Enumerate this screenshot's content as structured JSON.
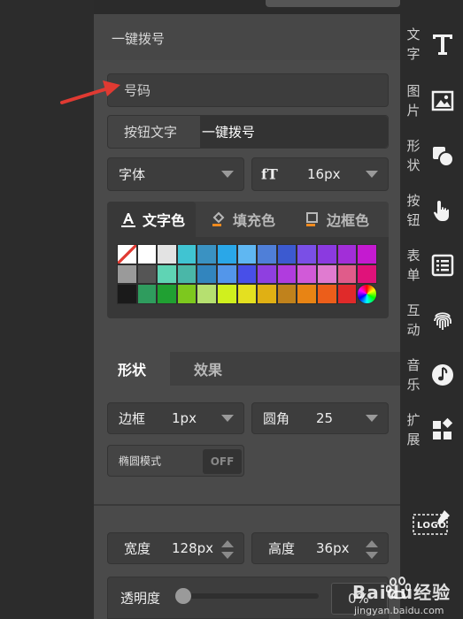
{
  "top_button_label": "",
  "panel": {
    "title": "一键拨号",
    "number_placeholder": "号码",
    "button_text_label": "按钮文字",
    "button_text_value": "一键拨号",
    "font_label": "字体",
    "font_size": "16px"
  },
  "color_tabs": [
    {
      "label": "文字色",
      "icon": "text-color-icon"
    },
    {
      "label": "填充色",
      "icon": "fill-bucket-icon"
    },
    {
      "label": "边框色",
      "icon": "border-color-icon"
    }
  ],
  "palette": [
    [
      "#ffffff",
      "#ffffff",
      "#e3e3e3",
      "#40c4d2",
      "#3a92c2",
      "#2aa7e8",
      "#5fb7f2",
      "#4f7fd8",
      "#3c5ad0",
      "#7a4fe6",
      "#8b3ae0",
      "#a22ed8",
      "#c41ad0"
    ],
    [
      "#9a9a9a",
      "#555555",
      "#5fd4b4",
      "#4ab7a8",
      "#3285be",
      "#5396ea",
      "#484fe8",
      "#8f3fe0",
      "#b03cde",
      "#d15ad8",
      "#e07bd0",
      "#e05c8a",
      "#e0127a"
    ],
    [
      "#1a1a1a",
      "#2f9c5e",
      "#20a032",
      "#7dc81e",
      "#b6e070",
      "#d0f01e",
      "#e4e020",
      "#e0b014",
      "#c0821c",
      "#e88414",
      "#ec5e1a",
      "#e02a2a",
      "rainbow"
    ]
  ],
  "shape_tabs": [
    "形状",
    "效果"
  ],
  "border": {
    "label": "边框",
    "value": "1px"
  },
  "radius": {
    "label": "圆角",
    "value": "25"
  },
  "ellipse": {
    "label": "椭圆模式",
    "toggle": "OFF"
  },
  "width": {
    "label": "宽度",
    "value": "128px"
  },
  "height": {
    "label": "高度",
    "value": "36px"
  },
  "opacity": {
    "label": "透明度",
    "value": "0%",
    "level": 0
  },
  "sidebar": [
    {
      "label": "文字",
      "icon": "text-T-icon"
    },
    {
      "label": "图片",
      "icon": "image-icon"
    },
    {
      "label": "形状",
      "icon": "shapes-icon"
    },
    {
      "label": "按钮",
      "icon": "hand-pointer-icon"
    },
    {
      "label": "表单",
      "icon": "form-list-icon"
    },
    {
      "label": "互动",
      "icon": "fingerprint-icon"
    },
    {
      "label": "音乐",
      "icon": "music-note-icon"
    },
    {
      "label": "扩展",
      "icon": "extension-grid-icon"
    }
  ],
  "logo_text": "LOGO",
  "watermark": {
    "brand": "Baidu经验",
    "url": "jingyan.baidu.com"
  },
  "colors": {
    "panel": "#4a4a4a",
    "sidebar": "#2b2b2b",
    "arrow": "#e03a32"
  }
}
